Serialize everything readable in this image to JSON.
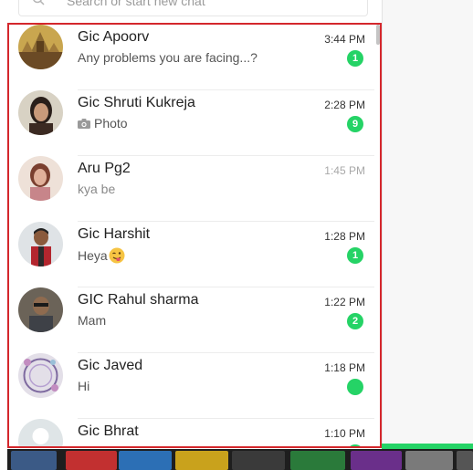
{
  "search": {
    "placeholder": "Search or start new chat"
  },
  "chats": [
    {
      "name": "Gic Apoorv",
      "time": "3:44 PM",
      "preview": "Any problems you are facing...?",
      "unread": "1"
    },
    {
      "name": "Gic Shruti Kukreja",
      "time": "2:28 PM",
      "preview": "Photo",
      "preview_icon": "camera-icon",
      "unread": "9"
    },
    {
      "name": "Aru Pg2",
      "time": "1:45 PM",
      "preview": "kya be",
      "unread": ""
    },
    {
      "name": "Gic Harshit",
      "time": "1:28 PM",
      "preview": "Heya",
      "preview_icon": "winking-tongue-emoji",
      "unread": "1"
    },
    {
      "name": "GIC Rahul sharma",
      "time": "1:22 PM",
      "preview": "Mam",
      "unread": "2"
    },
    {
      "name": "Gic Javed",
      "time": "1:18 PM",
      "preview": "Hi",
      "unread": ""
    },
    {
      "name": "Gic Bhrat",
      "time": "1:10 PM",
      "preview": "",
      "unread": ""
    }
  ],
  "colors": {
    "unread_badge": "#25d366",
    "highlight_border": "#d4272c",
    "time_active": "#333333",
    "time_muted": "#a8a8a8"
  }
}
